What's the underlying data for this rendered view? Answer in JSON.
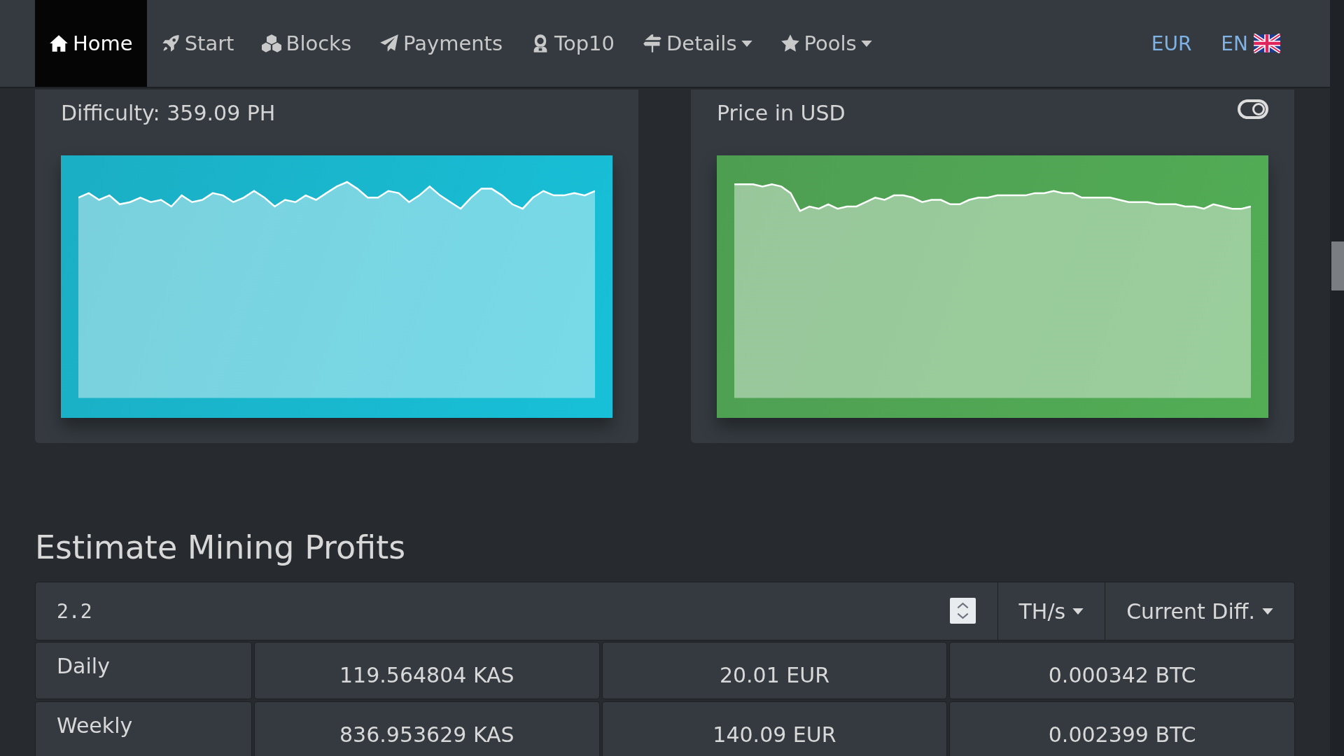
{
  "navbar": {
    "items": [
      {
        "label": "Home",
        "selected": true,
        "dropdown": false
      },
      {
        "label": "Start",
        "selected": false,
        "dropdown": false
      },
      {
        "label": "Blocks",
        "selected": false,
        "dropdown": false
      },
      {
        "label": "Payments",
        "selected": false,
        "dropdown": false
      },
      {
        "label": "Top10",
        "selected": false,
        "dropdown": false
      },
      {
        "label": "Details",
        "selected": false,
        "dropdown": true
      },
      {
        "label": "Pools",
        "selected": false,
        "dropdown": true
      }
    ],
    "currency": "EUR",
    "language": "EN"
  },
  "charts": [
    {
      "title": "Difficulty: 359.09 PH",
      "color": "#17c0d8",
      "toggle": false
    },
    {
      "title": "Price in USD",
      "color": "#52ad55",
      "toggle": true
    }
  ],
  "calculator": {
    "title": "Estimate Mining Profits",
    "hashrate": "2.2",
    "unit": "TH/s",
    "difficulty_mode": "Current Diff.",
    "rows": [
      {
        "period": "Daily",
        "values": [
          "119.564804 KAS",
          "20.01 EUR",
          "0.000342 BTC"
        ]
      },
      {
        "period": "Weekly",
        "values": [
          "836.953629 KAS",
          "140.09 EUR",
          "0.002399 BTC"
        ]
      }
    ]
  }
}
